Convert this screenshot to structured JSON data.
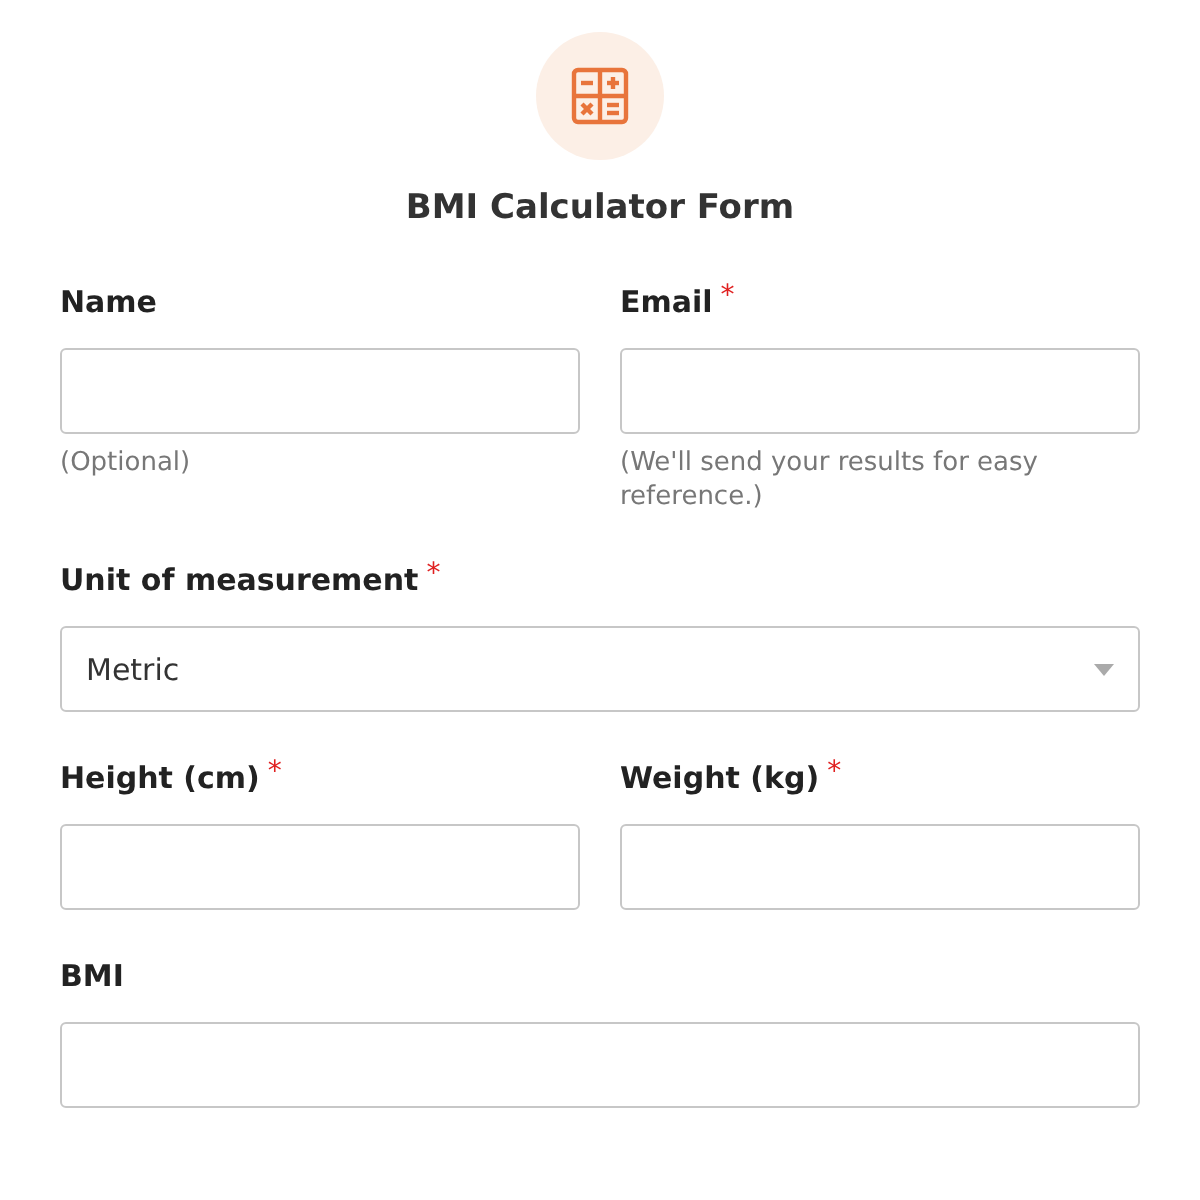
{
  "form": {
    "title": "BMI Calculator Form"
  },
  "rows": [
    {
      "fields": [
        {
          "kind": "text",
          "label": "Name",
          "help": "(Optional)"
        },
        {
          "kind": "text",
          "label": "Email",
          "required_mark": "*",
          "help": "(We'll send your results for easy reference.)"
        }
      ]
    },
    {
      "fields": [
        {
          "kind": "select",
          "label": "Unit of measurement",
          "required_mark": "*",
          "value": "Metric"
        }
      ]
    },
    {
      "fields": [
        {
          "kind": "text",
          "label": "Height (cm)",
          "required_mark": "*"
        },
        {
          "kind": "text",
          "label": "Weight (kg)",
          "required_mark": "*"
        }
      ]
    },
    {
      "fields": [
        {
          "kind": "text",
          "label": "BMI"
        }
      ]
    }
  ]
}
